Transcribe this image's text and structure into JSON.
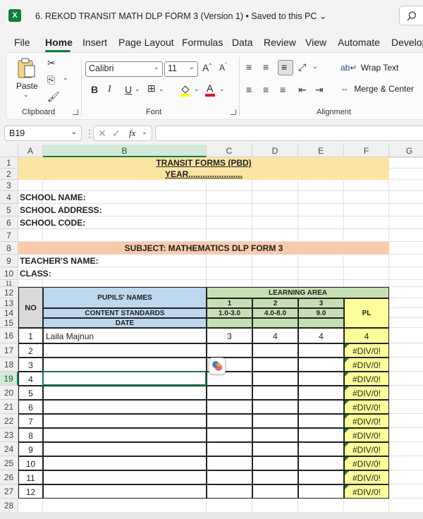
{
  "app": {
    "title": "6. REKOD TRANSIT MATH DLP FORM 3 (Version 1) • Saved to this PC ⌄",
    "logo": "X"
  },
  "menu": [
    "File",
    "Home",
    "Insert",
    "Page Layout",
    "Formulas",
    "Data",
    "Review",
    "View",
    "Automate",
    "Develop"
  ],
  "ribbon": {
    "paste_label": "Paste",
    "font_name": "Calibri",
    "font_size": "11",
    "grow_font": "A^",
    "shrink_font": "Aˇ",
    "bold": "B",
    "italic": "I",
    "underline": "U",
    "wrap_text": "Wrap Text",
    "merge_center": "Merge & Center",
    "groups": {
      "clipboard": "Clipboard",
      "font": "Font",
      "alignment": "Alignment"
    }
  },
  "formula_bar": {
    "name_box": "B19",
    "fx": "fx",
    "value": ""
  },
  "columns": [
    "A",
    "B",
    "C",
    "D",
    "E",
    "F",
    "G"
  ],
  "rows": [
    "1",
    "2",
    "3",
    "4",
    "5",
    "6",
    "7",
    "8",
    "9",
    "10",
    "11",
    "12",
    "13",
    "14",
    "15",
    "16",
    "17",
    "18",
    "19",
    "20",
    "21",
    "22",
    "23",
    "24",
    "25",
    "26",
    "27",
    "28"
  ],
  "sheet": {
    "title": "TRANSIT FORMS (PBD)",
    "year": "YEAR.......................",
    "school_name": "SCHOOL NAME:",
    "school_address": "SCHOOL ADDRESS:",
    "school_code": "SCHOOL CODE:",
    "subject": "SUBJECT: MATHEMATICS DLP FORM 3",
    "teacher": "TEACHER'S NAME:",
    "class": "CLASS:",
    "no": "NO",
    "pupils_names": "PUPILS' NAMES",
    "content_standards": "CONTENT STANDARDS",
    "date": "DATE",
    "learning_area": "LEARNING AREA",
    "la_cols": [
      "1",
      "2",
      "3"
    ],
    "la_ranges": [
      "1.0-3.0",
      "4.0-8.0",
      "9.0"
    ],
    "pl": "PL",
    "students": [
      {
        "no": "1",
        "name": "Laila Majnun",
        "c": "3",
        "d": "4",
        "e": "4",
        "pl": "4"
      },
      {
        "no": "2",
        "name": "",
        "c": "",
        "d": "",
        "e": "",
        "pl": "#DIV/0!"
      },
      {
        "no": "3",
        "name": "",
        "c": "",
        "d": "",
        "e": "",
        "pl": "#DIV/0!"
      },
      {
        "no": "4",
        "name": "",
        "c": "",
        "d": "",
        "e": "",
        "pl": "#DIV/0!"
      },
      {
        "no": "5",
        "name": "",
        "c": "",
        "d": "",
        "e": "",
        "pl": "#DIV/0!"
      },
      {
        "no": "6",
        "name": "",
        "c": "",
        "d": "",
        "e": "",
        "pl": "#DIV/0!"
      },
      {
        "no": "7",
        "name": "",
        "c": "",
        "d": "",
        "e": "",
        "pl": "#DIV/0!"
      },
      {
        "no": "8",
        "name": "",
        "c": "",
        "d": "",
        "e": "",
        "pl": "#DIV/0!"
      },
      {
        "no": "9",
        "name": "",
        "c": "",
        "d": "",
        "e": "",
        "pl": "#DIV/0!"
      },
      {
        "no": "10",
        "name": "",
        "c": "",
        "d": "",
        "e": "",
        "pl": "#DIV/0!"
      },
      {
        "no": "11",
        "name": "",
        "c": "",
        "d": "",
        "e": "",
        "pl": "#DIV/0!"
      },
      {
        "no": "12",
        "name": "",
        "c": "",
        "d": "",
        "e": "",
        "pl": "#DIV/0!"
      }
    ]
  },
  "colors": {
    "accent": "#107c41",
    "header_yellow": "#fce5a3",
    "subject_peach": "#f8cbad",
    "blue_header": "#bdd7ee",
    "green_header": "#c6e0b4",
    "pl_yellow": "#ffff99"
  }
}
